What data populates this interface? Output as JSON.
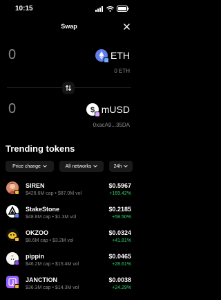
{
  "status": {
    "time": "10:15"
  },
  "header": {
    "title": "Swap"
  },
  "from": {
    "amount": "0",
    "token": "ETH",
    "balance": "0 ETH"
  },
  "to": {
    "amount": "0",
    "token": "mUSD",
    "address": "0xacA9...35DA"
  },
  "trending": {
    "title": "Trending tokens",
    "filters": {
      "price_change": "Price change",
      "networks": "All networks",
      "timeframe": "24h"
    },
    "tokens": [
      {
        "name": "SIREN",
        "meta": "$428.6M cap • $87.0M vol",
        "price": "$0.5967",
        "change": "+169.42%"
      },
      {
        "name": "StakeStone",
        "meta": "$48.8M cap • $1.3M vol",
        "price": "$0.2185",
        "change": "+58.50%"
      },
      {
        "name": "OKZOO",
        "meta": "$8.6M cap • $3.2M vol",
        "price": "$0.0324",
        "change": "+41.81%"
      },
      {
        "name": "pippin",
        "meta": "$46.2M cap • $15.4M vol",
        "price": "$0.0465",
        "change": "+28.61%"
      },
      {
        "name": "JANCTION",
        "meta": "$36.3M cap • $14.3M vol",
        "price": "$0.0038",
        "change": "+24.29%"
      }
    ]
  },
  "colors": {
    "positive": "#2fd36a",
    "muted": "#8b8b8b",
    "background": "#000000"
  }
}
